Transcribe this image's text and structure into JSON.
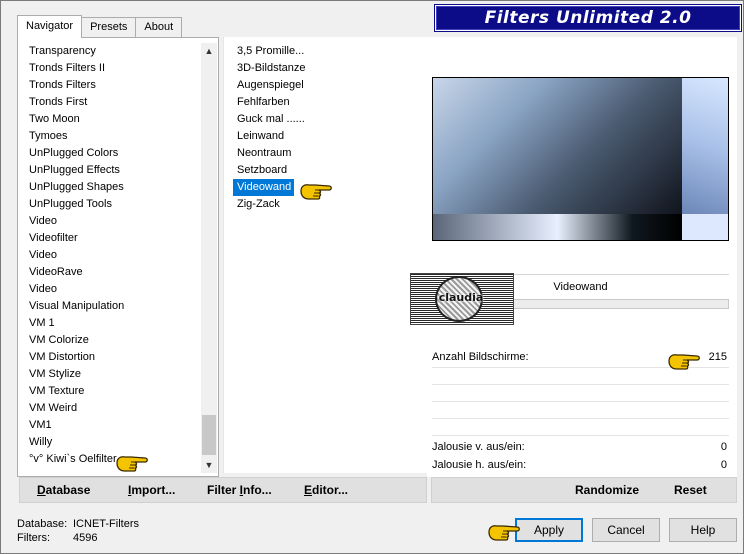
{
  "window": {
    "title": "Filters Unlimited 2.0"
  },
  "tabs": [
    {
      "label": "Navigator",
      "active": true
    },
    {
      "label": "Presets",
      "active": false
    },
    {
      "label": "About",
      "active": false
    }
  ],
  "categories": [
    "Transparency",
    "Tronds Filters II",
    "Tronds Filters",
    "Tronds First",
    "Two Moon",
    "Tymoes",
    "UnPlugged Colors",
    "UnPlugged Effects",
    "UnPlugged Shapes",
    "UnPlugged Tools",
    "Video",
    "Videofilter",
    "Video",
    "VideoRave",
    "Video",
    "Visual Manipulation",
    "VM 1",
    "VM Colorize",
    "VM Distortion",
    "VM Stylize",
    "VM Texture",
    "VM Weird",
    "VM1",
    "Willy",
    "°v° Kiwi`s Oelfilter"
  ],
  "filters": [
    {
      "label": "3,5 Promille...",
      "selected": false
    },
    {
      "label": "3D-Bildstanze",
      "selected": false
    },
    {
      "label": "Augenspiegel",
      "selected": false
    },
    {
      "label": "Fehlfarben",
      "selected": false
    },
    {
      "label": "Guck mal ......",
      "selected": false
    },
    {
      "label": "Leinwand",
      "selected": false
    },
    {
      "label": "Neontraum",
      "selected": false
    },
    {
      "label": "Setzboard",
      "selected": false
    },
    {
      "label": "Videowand",
      "selected": true
    },
    {
      "label": "Zig-Zack",
      "selected": false
    }
  ],
  "preview": {
    "filter_name": "Videowand"
  },
  "stamp": {
    "text": "claudia"
  },
  "params": {
    "anzahl": {
      "label": "Anzahl Bildschirme:",
      "value": "215"
    },
    "jalousie_v": {
      "label": "Jalousie v. aus/ein:",
      "value": "0"
    },
    "jalousie_h": {
      "label": "Jalousie h. aus/ein:",
      "value": "0"
    }
  },
  "toolbar": {
    "database": {
      "u": "D",
      "rest": "atabase"
    },
    "import": {
      "u": "I",
      "rest": "mport..."
    },
    "filter_info": {
      "pre": "Filter ",
      "u": "I",
      "rest": "nfo..."
    },
    "editor": {
      "u": "E",
      "rest": "ditor..."
    },
    "randomize": "Randomize",
    "reset": "Reset"
  },
  "status": {
    "database_label": "Database:",
    "database_value": "ICNET-Filters",
    "filters_label": "Filters:",
    "filters_value": "4596"
  },
  "buttons": {
    "apply": "Apply",
    "cancel": "Cancel",
    "help": "Help"
  },
  "colors": {
    "banner": "#0c0c88",
    "selection": "#0078d7",
    "pointer_hand": "#f5c400"
  }
}
